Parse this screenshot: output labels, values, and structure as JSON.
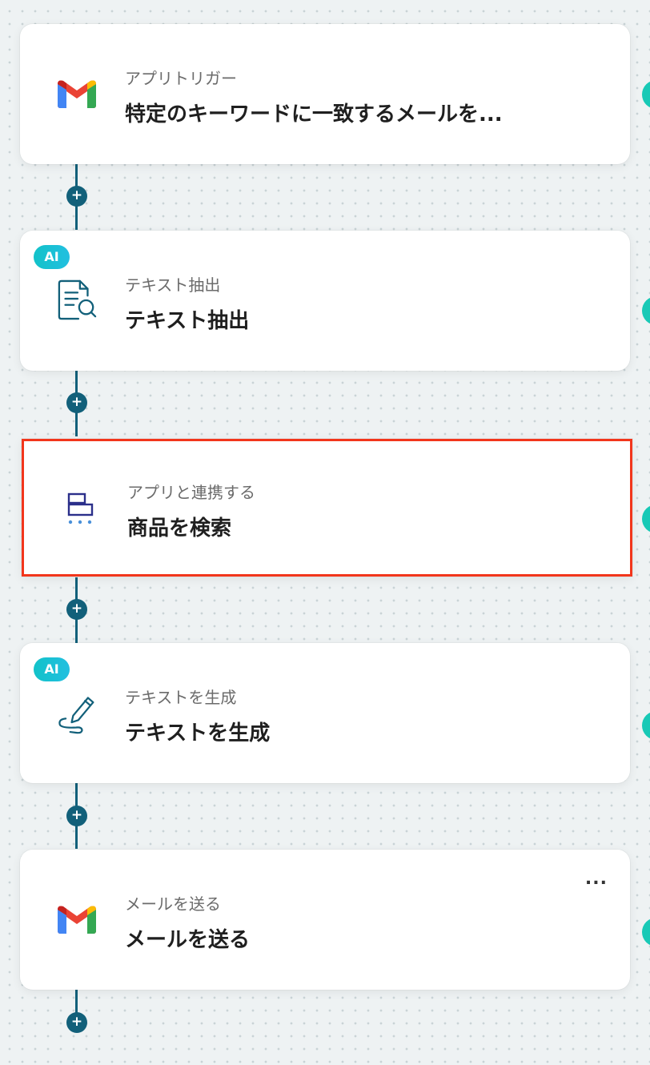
{
  "steps": [
    {
      "subtitle": "アプリトリガー",
      "title": "特定のキーワードに一致するメールを...",
      "icon": "gmail-icon",
      "ai": false
    },
    {
      "subtitle": "テキスト抽出",
      "title": "テキスト抽出",
      "icon": "document-search-icon",
      "ai": true,
      "ai_label": "AI"
    },
    {
      "subtitle": "アプリと連携する",
      "title": "商品を検索",
      "icon": "shop-cart-icon",
      "ai": false
    },
    {
      "subtitle": "テキストを生成",
      "title": "テキストを生成",
      "icon": "pen-line-icon",
      "ai": true,
      "ai_label": "AI"
    },
    {
      "subtitle": "メールを送る",
      "title": "メールを送る",
      "icon": "gmail-icon",
      "ai": false,
      "more": "..."
    }
  ],
  "add_step_label": "+",
  "colors": {
    "connector": "#12607a",
    "selected_border": "#f2361c",
    "ai_badge": "#12c2c9",
    "edge_handle": "#18c9b6"
  }
}
